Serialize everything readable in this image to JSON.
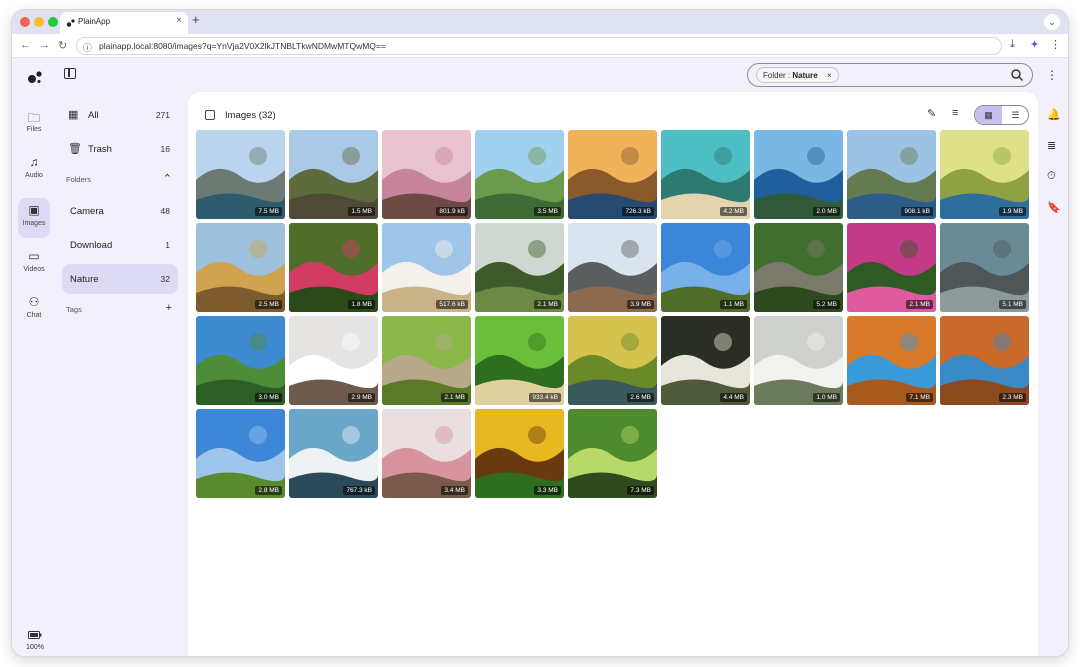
{
  "browser": {
    "tab_title": "PlainApp",
    "tab_close": "×",
    "new_tab": "+",
    "tab_menu": "⌄",
    "url": "plainapp.local:8080/images?q=YnVja2V0X2lkJTNBLTkwNDMwMTQwMQ==",
    "back": "←",
    "forward": "→",
    "reload": "↻",
    "site_icon": "ⓘ",
    "download_icon": "⤓",
    "extension_icon": "✦",
    "more_icon": "⋮"
  },
  "rail": {
    "items": [
      {
        "label": "Files",
        "icon": "folder-icon",
        "glyph": "🗀"
      },
      {
        "label": "Audio",
        "icon": "music-note-icon",
        "glyph": "♫"
      },
      {
        "label": "Images",
        "icon": "image-icon",
        "glyph": "▣"
      },
      {
        "label": "Videos",
        "icon": "video-icon",
        "glyph": "▭"
      },
      {
        "label": "Chat",
        "icon": "robot-icon",
        "glyph": "⚇"
      }
    ],
    "battery": "100%"
  },
  "panel": {
    "all": {
      "label": "All",
      "count": "271"
    },
    "trash": {
      "label": "Trash",
      "count": "16"
    },
    "folders_title": "Folders",
    "folders_toggle": "⌃",
    "folders": [
      {
        "label": "Camera",
        "count": "48"
      },
      {
        "label": "Download",
        "count": "1"
      },
      {
        "label": "Nature",
        "count": "32"
      }
    ],
    "tags_title": "Tags",
    "tags_add": "+"
  },
  "search": {
    "chip_label": "Folder :",
    "chip_value": "Nature",
    "chip_close": "×"
  },
  "main": {
    "title": "Images (32)",
    "edit_icon": "✎",
    "sort_icon": "≡",
    "grid_view": "▦",
    "list_view": "☰",
    "more": "⋮"
  },
  "right_rail": {
    "bell": "🔔",
    "queue": "≣",
    "timer": "⏱",
    "bookmark": "🔖"
  },
  "colors": {
    "accent": "#c5c2f2",
    "active_row": "#dcdaf4",
    "background": "#f2f0fb"
  },
  "images": [
    {
      "size": "7.5 MB",
      "scene": "mountain-lake"
    },
    {
      "size": "1.5 MB",
      "scene": "waterfall-canyon"
    },
    {
      "size": "801.9 kB",
      "scene": "pink-blossoms"
    },
    {
      "size": "3.5 MB",
      "scene": "green-valley"
    },
    {
      "size": "726.3 kB",
      "scene": "sunset-lake"
    },
    {
      "size": "4.2 MB",
      "scene": "turquoise-coast"
    },
    {
      "size": "2.0 MB",
      "scene": "sea-island"
    },
    {
      "size": "908.1 kB",
      "scene": "sea-cliffs"
    },
    {
      "size": "1.9 MB",
      "scene": "kingfisher-birds"
    },
    {
      "size": "2.5 MB",
      "scene": "giraffe"
    },
    {
      "size": "1.8 MB",
      "scene": "pink-lotus"
    },
    {
      "size": "517.6 kB",
      "scene": "white-blossom"
    },
    {
      "size": "2.1 MB",
      "scene": "forest-pond"
    },
    {
      "size": "3.9 MB",
      "scene": "snowy-waterfall"
    },
    {
      "size": "1.1 MB",
      "scene": "lone-tree-sky"
    },
    {
      "size": "5.2 MB",
      "scene": "forest-path"
    },
    {
      "size": "2.1 MB",
      "scene": "magenta-flowers"
    },
    {
      "size": "5.1 MB",
      "scene": "rocky-shore"
    },
    {
      "size": "3.0 MB",
      "scene": "green-hills"
    },
    {
      "size": "2.9 MB",
      "scene": "magnolia"
    },
    {
      "size": "2.1 MB",
      "scene": "bird-fountain"
    },
    {
      "size": "933.4 kB",
      "scene": "butterflies"
    },
    {
      "size": "2.6 MB",
      "scene": "river-valley"
    },
    {
      "size": "4.4 MB",
      "scene": "white-roses-dark"
    },
    {
      "size": "1.0 MB",
      "scene": "white-flowers-grey"
    },
    {
      "size": "7.1 MB",
      "scene": "autumn-river"
    },
    {
      "size": "2.3 MB",
      "scene": "autumn-canal"
    },
    {
      "size": "2.8 MB",
      "scene": "blue-sky-meadow"
    },
    {
      "size": "767.3 kB",
      "scene": "snowy-peaks"
    },
    {
      "size": "3.4 MB",
      "scene": "pink-white-blossom"
    },
    {
      "size": "3.3 MB",
      "scene": "sunflower"
    },
    {
      "size": "7.3 MB",
      "scene": "forest-stream"
    }
  ]
}
